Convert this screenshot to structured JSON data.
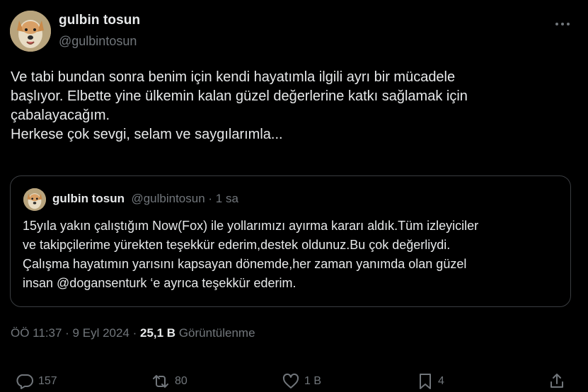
{
  "author": {
    "name": "gulbin tosun",
    "handle": "@gulbintosun"
  },
  "tweet": {
    "lines": [
      "Ve tabi bundan sonra benim için kendi hayatımla ilgili ayrı bir mücadele",
      "başlıyor. Elbette yine  ülkemin kalan güzel değerlerine katkı sağlamak için",
      "çabalayacağım.",
      "Herkese çok sevgi, selam ve saygılarımla..."
    ]
  },
  "quote": {
    "name": "gulbin tosun",
    "meta": "@gulbintosun · 1 sa",
    "lines": [
      "15yıla yakın çalıştığım Now(Fox) ile yollarımızı ayırma kararı aldık.Tüm izleyiciler",
      "ve takipçilerime yürekten teşekkür ederim,destek oldunuz.Bu çok değerliydi.",
      "Çalışma hayatımın yarısını kapsayan dönemde,her zaman yanımda olan güzel",
      "insan @dogansenturk ‘e ayrıca teşekkür ederim."
    ]
  },
  "meta": {
    "timestamp": "ÖÖ 11:37 · 9 Eyl 2024 · ",
    "views_count": "25,1 B",
    "views_label": " Görüntülenme"
  },
  "actions": {
    "replies": "157",
    "reposts": "80",
    "likes": "1 B",
    "bookmarks": "4"
  },
  "icons": {
    "more": "more-horizontal-icon",
    "reply": "reply-icon",
    "repost": "repost-icon",
    "like": "heart-icon",
    "bookmark": "bookmark-icon",
    "share": "share-icon"
  },
  "colors": {
    "background": "#000000",
    "text": "#e7e9ea",
    "secondary": "#71767b",
    "border": "#3a3d41"
  }
}
